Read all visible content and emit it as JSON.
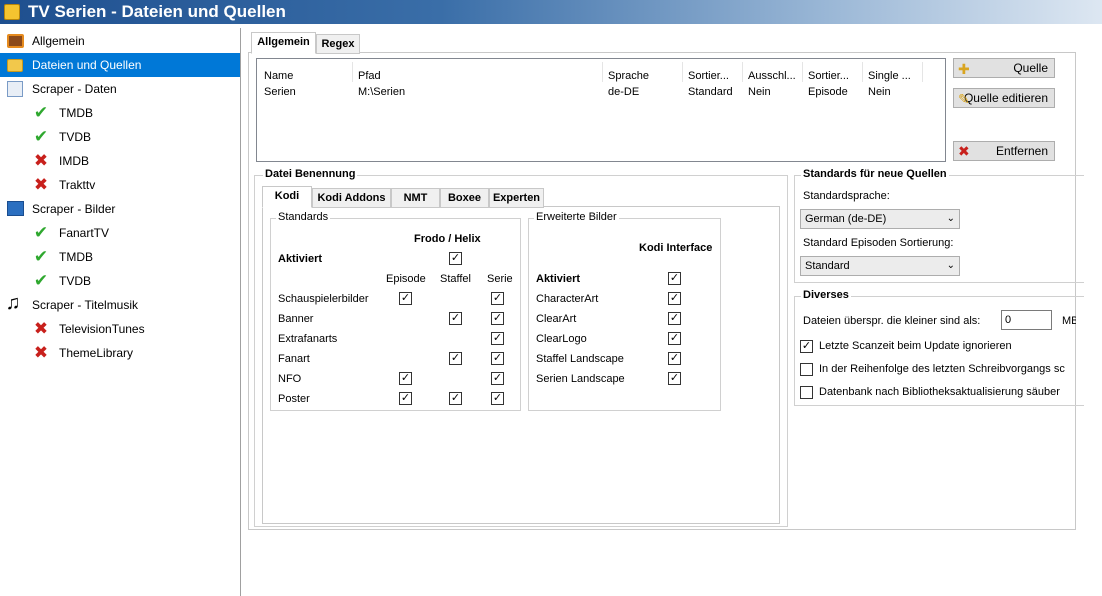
{
  "window": {
    "title": "TV Serien - Dateien und Quellen"
  },
  "sidebar": {
    "items": [
      {
        "label": "Allgemein",
        "icon": "tv-icon"
      },
      {
        "label": "Dateien und Quellen",
        "icon": "folder-icon",
        "selected": true
      },
      {
        "label": "Scraper - Daten",
        "icon": "document-icon"
      },
      {
        "label": "TMDB",
        "icon": "check-icon"
      },
      {
        "label": "TVDB",
        "icon": "check-icon"
      },
      {
        "label": "IMDB",
        "icon": "cross-icon"
      },
      {
        "label": "Trakttv",
        "icon": "cross-icon"
      },
      {
        "label": "Scraper - Bilder",
        "icon": "picture-icon"
      },
      {
        "label": "FanartTV",
        "icon": "check-icon"
      },
      {
        "label": "TMDB",
        "icon": "check-icon"
      },
      {
        "label": "TVDB",
        "icon": "check-icon"
      },
      {
        "label": "Scraper - Titelmusik",
        "icon": "music-icon"
      },
      {
        "label": "TelevisionTunes",
        "icon": "cross-icon"
      },
      {
        "label": "ThemeLibrary",
        "icon": "cross-icon"
      }
    ]
  },
  "top_tabs": [
    "Allgemein",
    "Regex"
  ],
  "sources_table": {
    "columns": [
      "Name",
      "Pfad",
      "Sprache",
      "Sortier...",
      "Ausschl...",
      "Sortier...",
      "Single ..."
    ],
    "rows": [
      [
        "Serien",
        "M:\\Serien",
        "de-DE",
        "Standard",
        "Nein",
        "Episode",
        "Nein"
      ]
    ]
  },
  "buttons": {
    "add": "Quelle",
    "edit": "Quelle editieren",
    "remove": "Entfernen"
  },
  "naming": {
    "title": "Datei Benennung",
    "tabs": [
      "Kodi",
      "Kodi Addons",
      "NMT",
      "Boxee",
      "Experten"
    ],
    "standards": {
      "legend": "Standards",
      "group_header": "Frodo / Helix",
      "activated": "Aktiviert",
      "col_episode": "Episode",
      "col_season": "Staffel",
      "col_series": "Serie",
      "rows": [
        "Schauspielerbilder",
        "Banner",
        "Extrafanarts",
        "Fanart",
        "NFO",
        "Poster"
      ]
    },
    "extended": {
      "legend": "Erweiterte Bilder",
      "header": "Kodi Interface",
      "activated": "Aktiviert",
      "rows": [
        "CharacterArt",
        "ClearArt",
        "ClearLogo",
        "Staffel Landscape",
        "Serien Landscape"
      ]
    }
  },
  "defaults": {
    "title": "Standards für neue Quellen",
    "language_label": "Standardsprache:",
    "language_value": "German (de-DE)",
    "episode_sort_label": "Standard Episoden Sortierung:",
    "episode_sort_value": "Standard"
  },
  "misc": {
    "title": "Diverses",
    "skip_label": "Dateien überspr. die kleiner sind als:",
    "skip_value": "0",
    "skip_unit": "MB",
    "opt1": "Letzte Scanzeit beim Update ignorieren",
    "opt2": "In der Reihenfolge des letzten Schreibvorgangs sc",
    "opt3": "Datenbank nach Bibliotheksaktualisierung säuber"
  }
}
